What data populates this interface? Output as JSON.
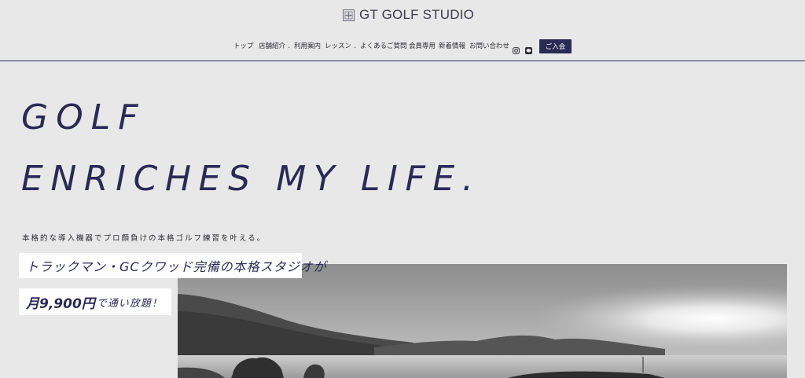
{
  "header": {
    "logo_text": "GT GOLF STUDIO",
    "logo_icon": "studio-logo-icon",
    "nav": [
      {
        "label": "トップ"
      },
      {
        "label": "店舗紹介",
        "has_dropdown": true
      },
      {
        "label": "利用案内"
      },
      {
        "label": "レッスン",
        "has_dropdown": true
      },
      {
        "label": "よくあるご質問"
      },
      {
        "label": "会員専用"
      },
      {
        "label": "新着情報"
      },
      {
        "label": "お問い合わせ"
      }
    ],
    "caret": "⌄",
    "social_icons": [
      "instagram-icon",
      "line-icon"
    ],
    "join_label": "ご入会"
  },
  "hero": {
    "line1": "GOLF",
    "line2": "ENRICHES MY LIFE.",
    "subcopy": "本格的な導入機器でプロ顔負けの本格ゴルフ練習を叶える。",
    "caption1": "トラックマン・GCクワッド完備の本格スタジオが",
    "caption2_price": "月9,900円",
    "caption2_rest": "で通い放題！"
  },
  "colors": {
    "background": "#e8e8e9",
    "accent": "#2b2a55",
    "caption_bg": "#ffffff"
  }
}
